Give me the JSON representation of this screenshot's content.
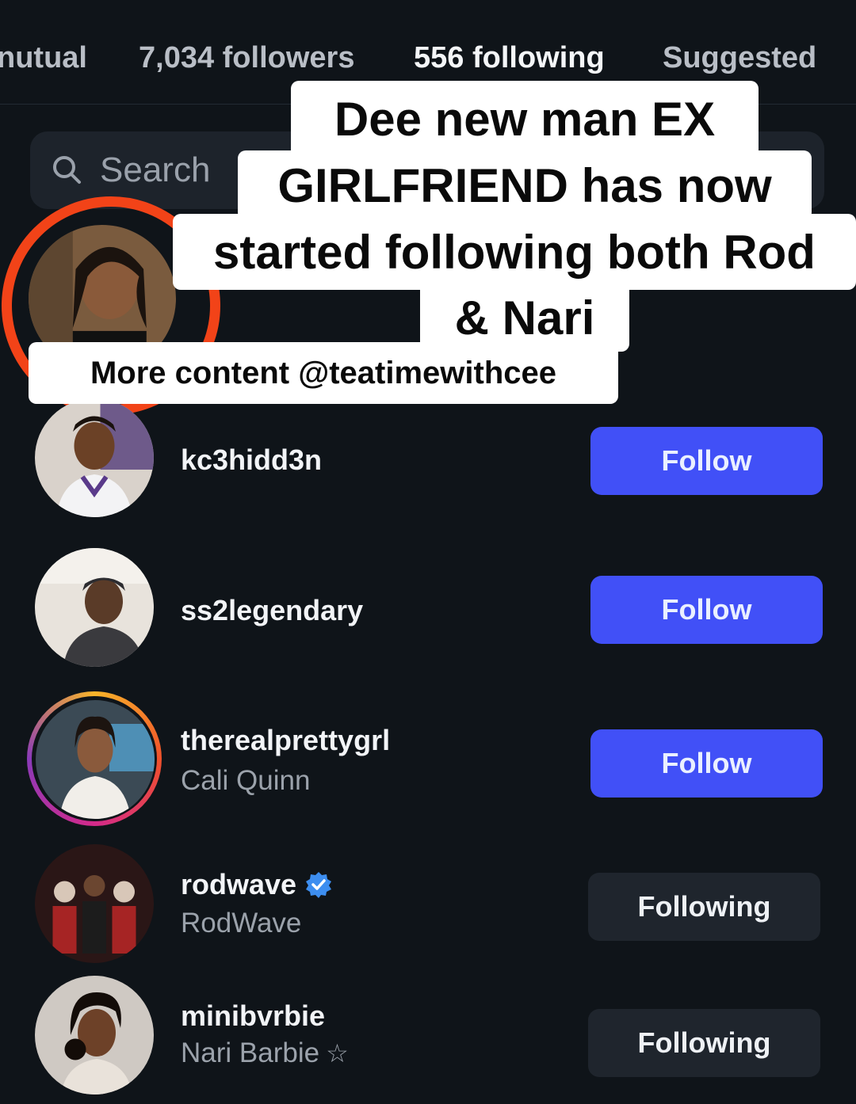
{
  "tabs": {
    "mutual": "nutual",
    "followers": "7,034 followers",
    "following": "556 following",
    "suggested": "Suggested"
  },
  "search": {
    "placeholder": "Search"
  },
  "caption": {
    "line1": "Dee new man EX",
    "line2": "GIRLFRIEND has now",
    "line3": "started following both Rod",
    "line4": "& Nari",
    "credit": "More content @teatimewithcee"
  },
  "users": [
    {
      "username": "kc3hidd3n",
      "display": "",
      "button": "Follow"
    },
    {
      "username": "ss2legendary",
      "display": "",
      "button": "Follow"
    },
    {
      "username": "therealprettygrl",
      "display": "Cali Quinn",
      "button": "Follow"
    },
    {
      "username": "rodwave",
      "display": "RodWave",
      "button": "Following",
      "verified": true
    },
    {
      "username": "minibvrbie",
      "display": "Nari Barbie",
      "button": "Following",
      "star": "☆"
    }
  ],
  "colors": {
    "background": "#0f1419",
    "follow_button": "#4150f7",
    "following_button": "#1f252d",
    "highlight_circle": "#f24318",
    "verified": "#3d8ef0"
  }
}
